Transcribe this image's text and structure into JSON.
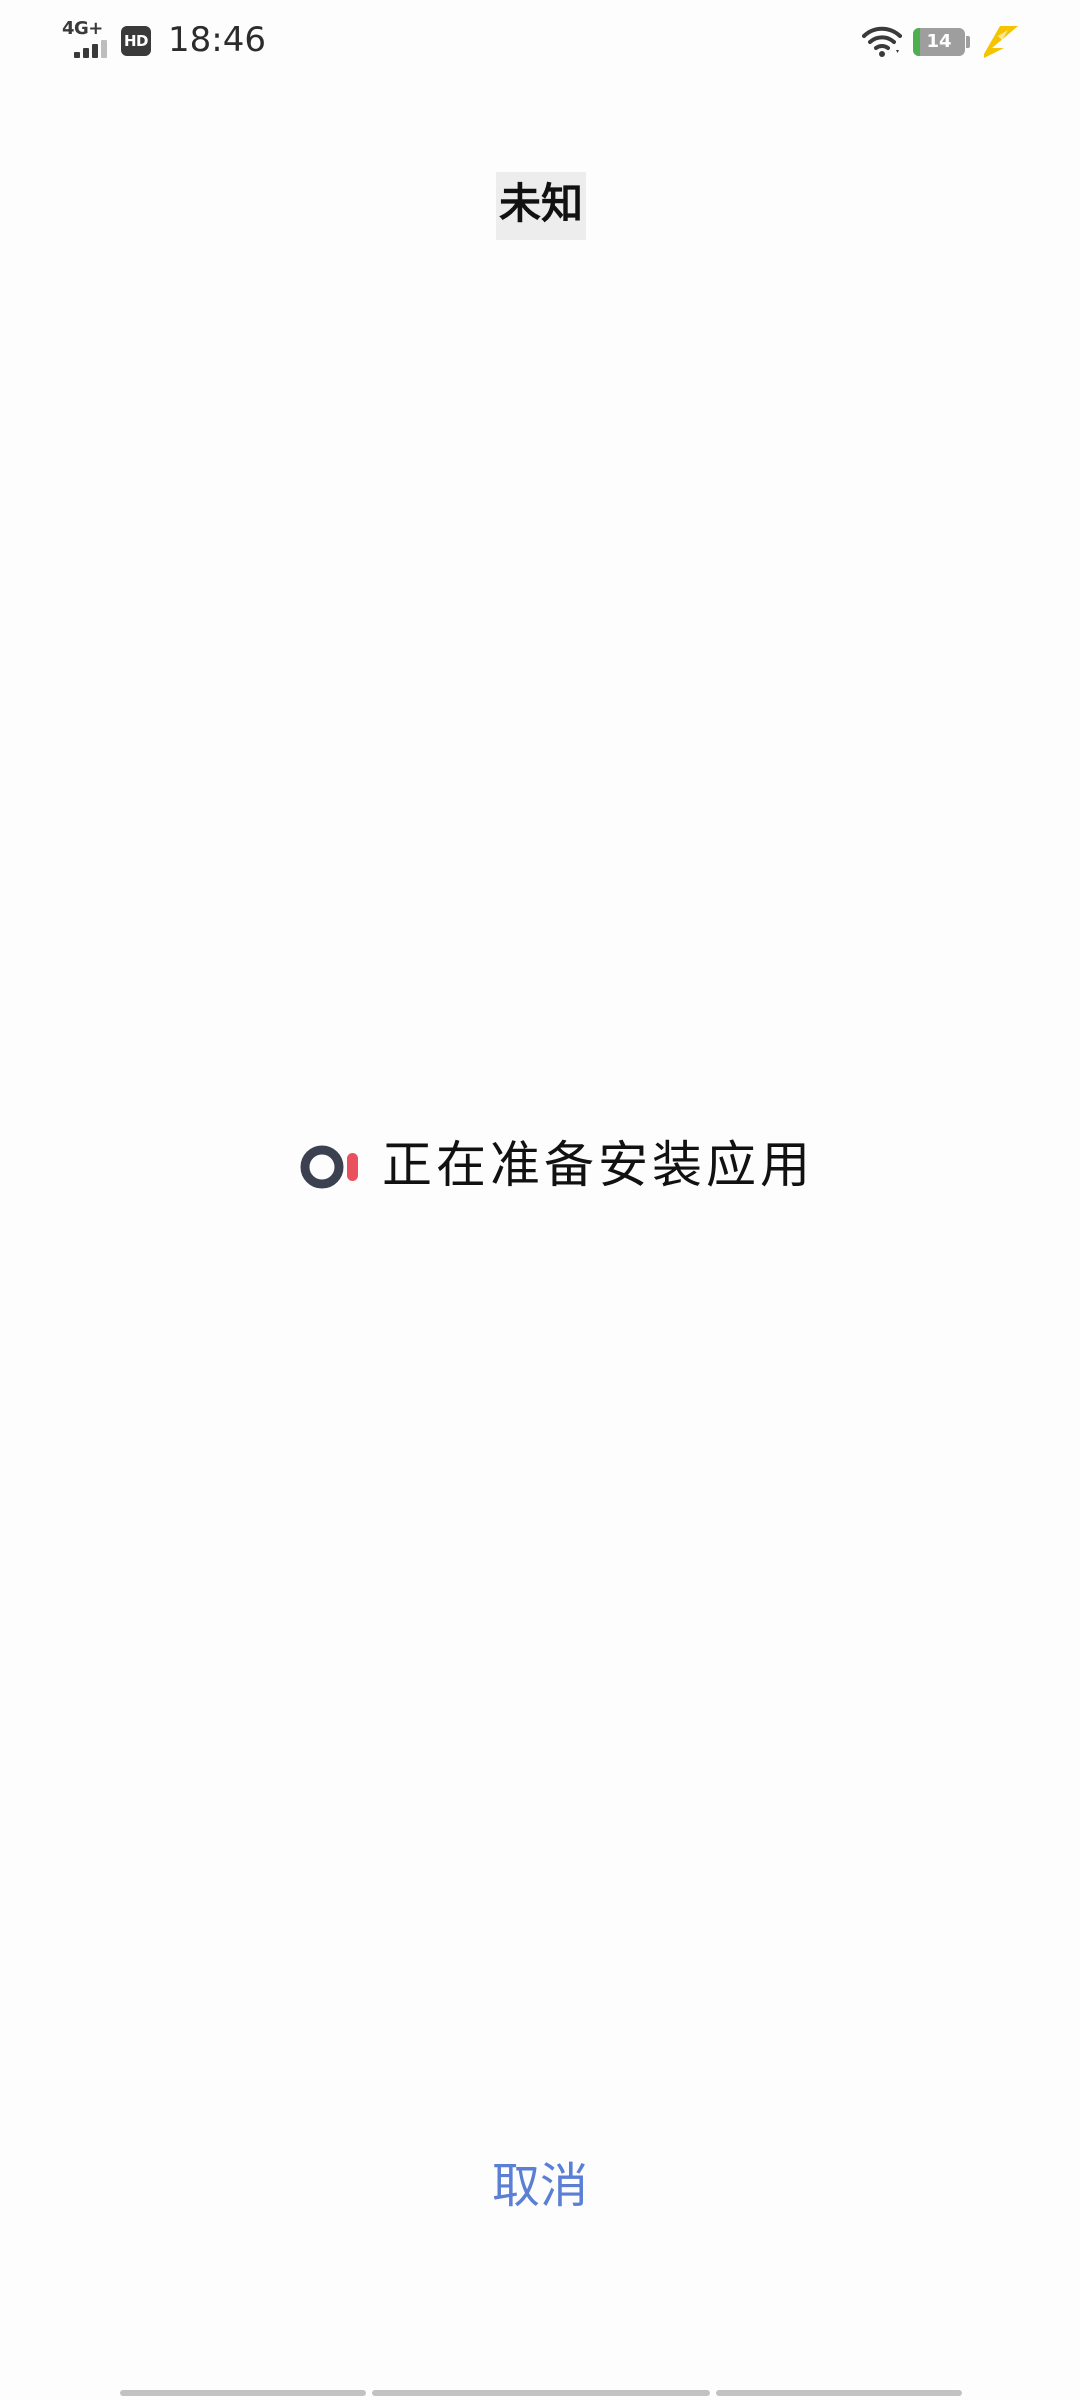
{
  "status_bar": {
    "network_type": "4G+",
    "hd_label": "HD",
    "time": "18:46",
    "battery_level": "14",
    "battery_fraction": 0.14,
    "signal_icon": "cellular-signal-icon",
    "wifi_icon": "wifi-icon",
    "charging_icon": "charging-bolt-icon"
  },
  "dialog": {
    "title": "未知",
    "progress_text": "正在准备安装应用",
    "loading_icon": "loading-spinner-icon",
    "cancel_label": "取消"
  },
  "colors": {
    "background": "#fdfdfd",
    "accent": "#5b7fd4",
    "spinner_ring": "#3b4150",
    "spinner_dot": "#e9515f",
    "battery_green": "#4caf50",
    "charging_yellow": "#f5c400"
  }
}
